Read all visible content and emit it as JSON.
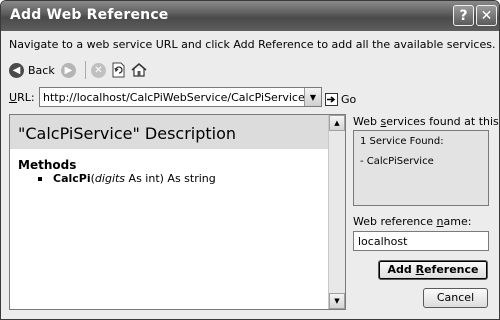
{
  "window": {
    "title": "Add Web Reference",
    "help_label": "?",
    "close_label": "✕"
  },
  "instruction": "Navigate to a web service URL and click Add Reference to add all the available services.",
  "toolbar": {
    "back_label": "Back",
    "back_icon": "back-arrow-icon",
    "forward_icon": "forward-arrow-icon",
    "stop_icon": "stop-icon",
    "refresh_icon": "refresh-icon",
    "home_icon": "home-icon"
  },
  "url": {
    "label_prefix": "U",
    "label_rest": "RL:",
    "value": "http://localhost/CalcPiWebService/CalcPiService.asmx?WSDL",
    "go_label": "Go"
  },
  "browser": {
    "title": "\"CalcPiService\" Description",
    "methods_heading": "Methods",
    "method": {
      "name": "CalcPi",
      "open": "(",
      "param": "digits",
      "rest": " As int) As string"
    }
  },
  "services": {
    "label_before": "Web ",
    "label_u": "s",
    "label_after": "ervices found at this URL:",
    "count": "1 Service Found:",
    "items": [
      "- CalcPiService"
    ]
  },
  "reference": {
    "label_before": "Web reference ",
    "label_u": "n",
    "label_after": "ame:",
    "value": "localhost"
  },
  "buttons": {
    "add_before": "Add ",
    "add_u": "R",
    "add_after": "eference",
    "cancel": "Cancel"
  }
}
